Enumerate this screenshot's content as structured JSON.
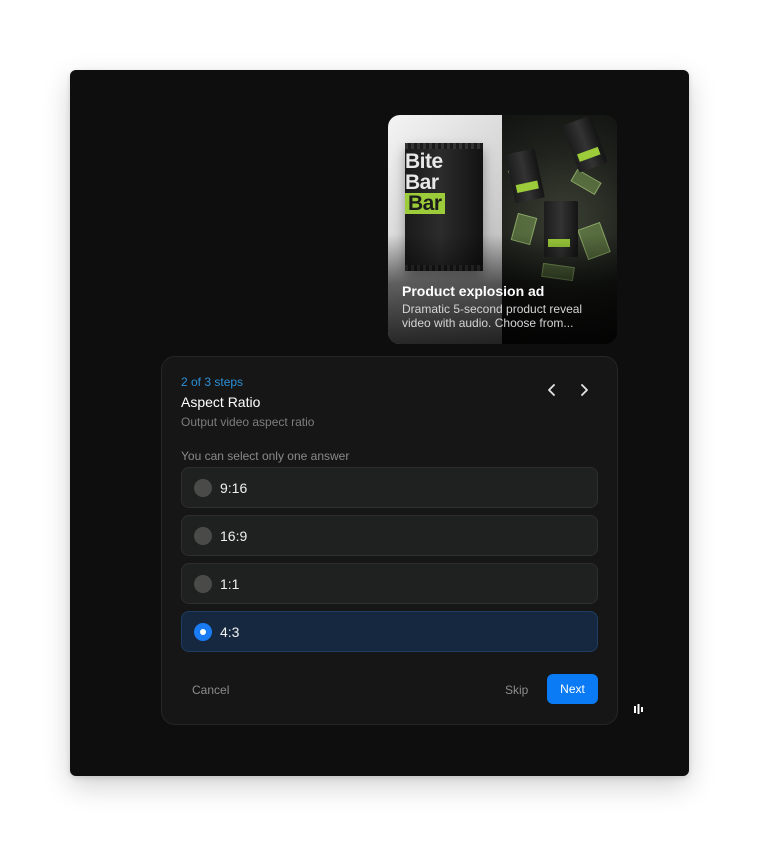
{
  "preview_card": {
    "title": "Product explosion ad",
    "description": "Dramatic 5-second product reveal video with audio. Choose from...",
    "image_left_icon": "product-packshot-image",
    "image_right_icon": "product-explosion-image",
    "pack_logo_lines": [
      "Bite",
      "Bar",
      "Bar"
    ],
    "pack_accent_color": "#9ccc3a"
  },
  "question": {
    "step_label": "2 of 3 steps",
    "title": "Aspect Ratio",
    "subtitle": "Output video aspect ratio",
    "hint": "You can select only one answer",
    "nav": {
      "prev_icon": "chevron-left-icon",
      "next_icon": "chevron-right-icon"
    },
    "options": [
      {
        "label": "9:16",
        "selected": false
      },
      {
        "label": "16:9",
        "selected": false
      },
      {
        "label": "1:1",
        "selected": false
      },
      {
        "label": "4:3",
        "selected": true
      }
    ]
  },
  "actions": {
    "cancel_label": "Cancel",
    "skip_label": "Skip",
    "next_label": "Next"
  },
  "colors": {
    "window_bg": "#0e0e0e",
    "accent": "#0a7bf5",
    "step_label": "#2b8fd6",
    "selected_option_bg": "#162840"
  },
  "brand_icon": "app-logo-icon"
}
